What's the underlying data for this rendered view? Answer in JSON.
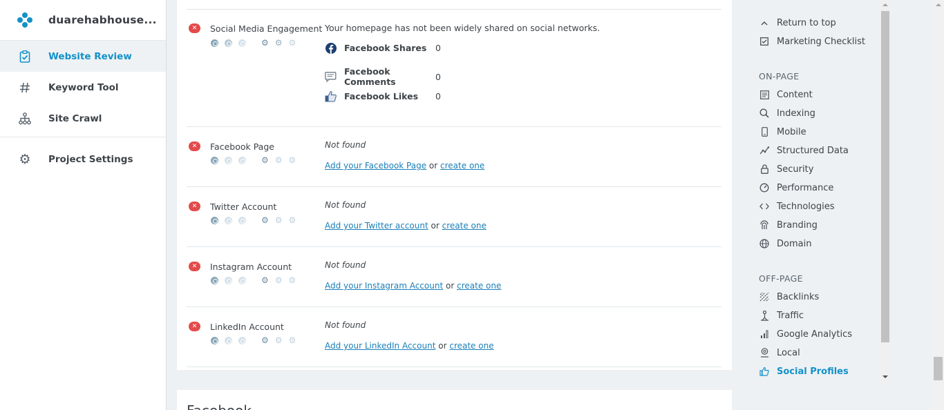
{
  "leftnav": {
    "project_name": "duarehabhouse...",
    "items": [
      {
        "label": "Website Review",
        "icon": "clipboard-check-icon"
      },
      {
        "label": "Keyword Tool",
        "icon": "hash-icon"
      },
      {
        "label": "Site Crawl",
        "icon": "sitemap-icon"
      }
    ],
    "settings_label": "Project Settings"
  },
  "social": {
    "engagement": {
      "title": "Social Media Engagement",
      "status": "fail",
      "description": "Your homepage has not been widely shared on social networks.",
      "metrics": [
        {
          "label": "Facebook Shares",
          "value": "0"
        },
        {
          "label": "Facebook Comments",
          "value": "0"
        },
        {
          "label": "Facebook Likes",
          "value": "0"
        }
      ]
    },
    "profiles": [
      {
        "title": "Facebook Page",
        "status_text": "Not found",
        "add_link": "Add your Facebook Page",
        "or": "or",
        "create_link": "create one"
      },
      {
        "title": "Twitter Account",
        "status_text": "Not found",
        "add_link": "Add your Twitter account",
        "or": "or",
        "create_link": "create one"
      },
      {
        "title": "Instagram Account",
        "status_text": "Not found",
        "add_link": "Add your Instagram Account",
        "or": "or",
        "create_link": "create one"
      },
      {
        "title": "LinkedIn Account",
        "status_text": "Not found",
        "add_link": "Add your LinkedIn Account",
        "or": "or",
        "create_link": "create one"
      }
    ]
  },
  "next_section": {
    "title": "Facebook"
  },
  "rightnav": {
    "return_top": "Return to top",
    "checklist": "Marketing Checklist",
    "onpage_heading": "ON-PAGE",
    "onpage": [
      "Content",
      "Indexing",
      "Mobile",
      "Structured Data",
      "Security",
      "Performance",
      "Technologies",
      "Branding",
      "Domain"
    ],
    "offpage_heading": "OFF-PAGE",
    "offpage": [
      "Backlinks",
      "Traffic",
      "Google Analytics",
      "Local",
      "Social Profiles"
    ],
    "active": "Social Profiles"
  },
  "colors": {
    "accent": "#1391c9",
    "fail": "#e34b4b",
    "link": "#1a7fb8"
  }
}
